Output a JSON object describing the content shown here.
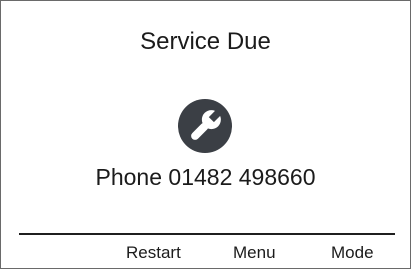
{
  "screen": {
    "title": "Service Due",
    "icon": "wrench-icon",
    "icon_color": "#3b3f45",
    "phone_text": "Phone 01482 498660"
  },
  "softkeys": [
    {
      "label": ""
    },
    {
      "label": "Restart"
    },
    {
      "label": "Menu"
    },
    {
      "label": "Mode"
    }
  ]
}
